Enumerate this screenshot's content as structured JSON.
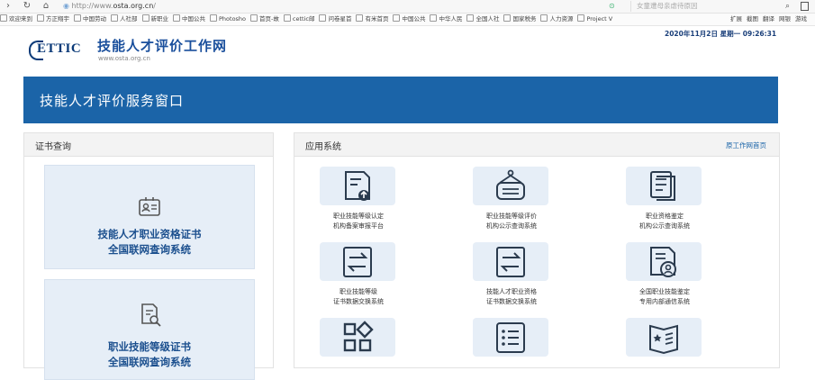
{
  "browser": {
    "url_prefix": "http://www.",
    "url_host": "osta.org.cn",
    "url_suffix": "/",
    "search_placeholder": "女童遭母亲虐待原因",
    "bookmarks": [
      "欢迎来到",
      "方正翔宇",
      "中国劳动",
      "人社部",
      "新职业",
      "中国公共",
      "Photosho",
      "首页-故",
      "cettic邮",
      "问卷星首",
      "有米首页",
      "中国公共",
      "中华人民",
      "全国人社",
      "国家税务",
      "人力资源",
      "Project V"
    ],
    "bookmarks_right": [
      "扩展",
      "截图",
      "翻译",
      "网银",
      "游戏"
    ]
  },
  "header": {
    "logo_text": "ETTIC",
    "site_title": "技能人才评价工作网",
    "site_url": "www.osta.org.cn",
    "datetime": "2020年11月2日  星期一  09:26:31"
  },
  "banner": {
    "title": "技能人才评价服务窗口"
  },
  "left_panel": {
    "title": "证书查询",
    "cards": [
      {
        "icon": "id-card-icon",
        "line1": "技能人才职业资格证书",
        "line2": "全国联网查询系统"
      },
      {
        "icon": "certificate-search-icon",
        "line1": "职业技能等级证书",
        "line2": "全国联网查询系统"
      }
    ]
  },
  "right_panel": {
    "title": "应用系统",
    "link": "原工作网首页",
    "apps": [
      {
        "icon": "document-upload-icon",
        "line1": "职业技能等级认定",
        "line2": "机构备案审报平台"
      },
      {
        "icon": "signboard-icon",
        "line1": "职业技能等级评价",
        "line2": "机构公示查询系统"
      },
      {
        "icon": "documents-icon",
        "line1": "职业资格鉴定",
        "line2": "机构公示查询系统"
      },
      {
        "icon": "exchange-icon",
        "line1": "职业技能等级",
        "line2": "证书数据交换系统"
      },
      {
        "icon": "exchange-icon",
        "line1": "技能人才职业资格",
        "line2": "证书数据交换系统"
      },
      {
        "icon": "person-document-icon",
        "line1": "全国职业技能鉴定",
        "line2": "专用内部通信系统"
      },
      {
        "icon": "apps-grid-icon",
        "line1": "",
        "line2": ""
      },
      {
        "icon": "list-icon",
        "line1": "",
        "line2": ""
      },
      {
        "icon": "star-book-icon",
        "line1": "",
        "line2": ""
      }
    ]
  },
  "colors": {
    "brand_blue": "#1b64a8",
    "card_bg": "#e6eef7",
    "title_blue": "#1b4f8e"
  }
}
